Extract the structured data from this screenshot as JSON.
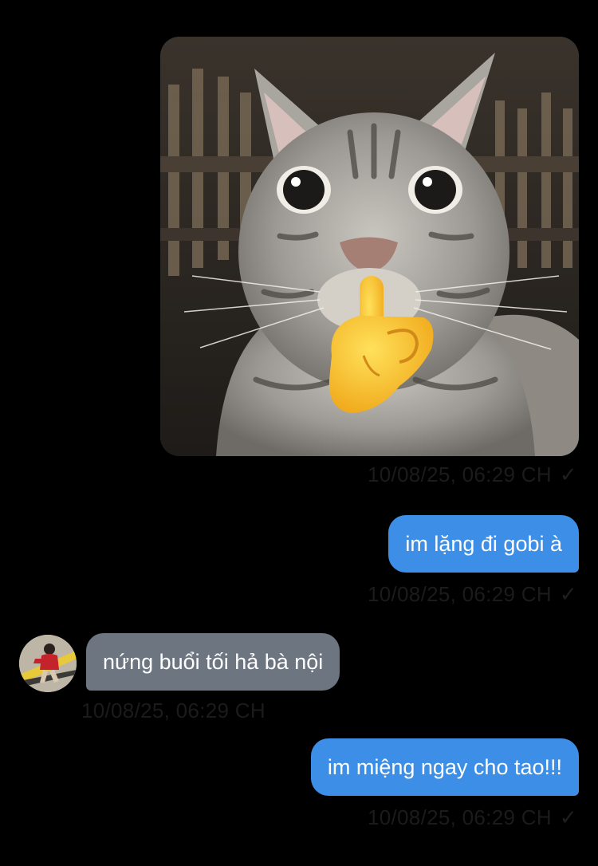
{
  "chat": {
    "messages": [
      {
        "type": "image",
        "direction": "outgoing",
        "image_description": "gray tabby cat with shushing finger emoji",
        "timestamp": "10/08/25, 06:29 CH",
        "status_icon": "check-icon"
      },
      {
        "type": "text",
        "direction": "outgoing",
        "text": "im lặng đi gobi à",
        "timestamp": "10/08/25, 06:29 CH",
        "status_icon": "check-icon"
      },
      {
        "type": "text",
        "direction": "incoming",
        "text": "nứng buổi tối hả bà nội",
        "timestamp": "10/08/25, 06:29 CH",
        "avatar_icon": "avatar"
      },
      {
        "type": "text",
        "direction": "outgoing",
        "text": "im miệng ngay cho tao!!!",
        "timestamp": "10/08/25, 06:29 CH",
        "status_icon": "check-icon"
      }
    ]
  },
  "icons": {
    "check": "✓"
  },
  "colors": {
    "background": "#000000",
    "outgoing_bubble": "#3d8ee6",
    "incoming_bubble": "#6c7580",
    "timestamp": "#1b1b1b"
  }
}
